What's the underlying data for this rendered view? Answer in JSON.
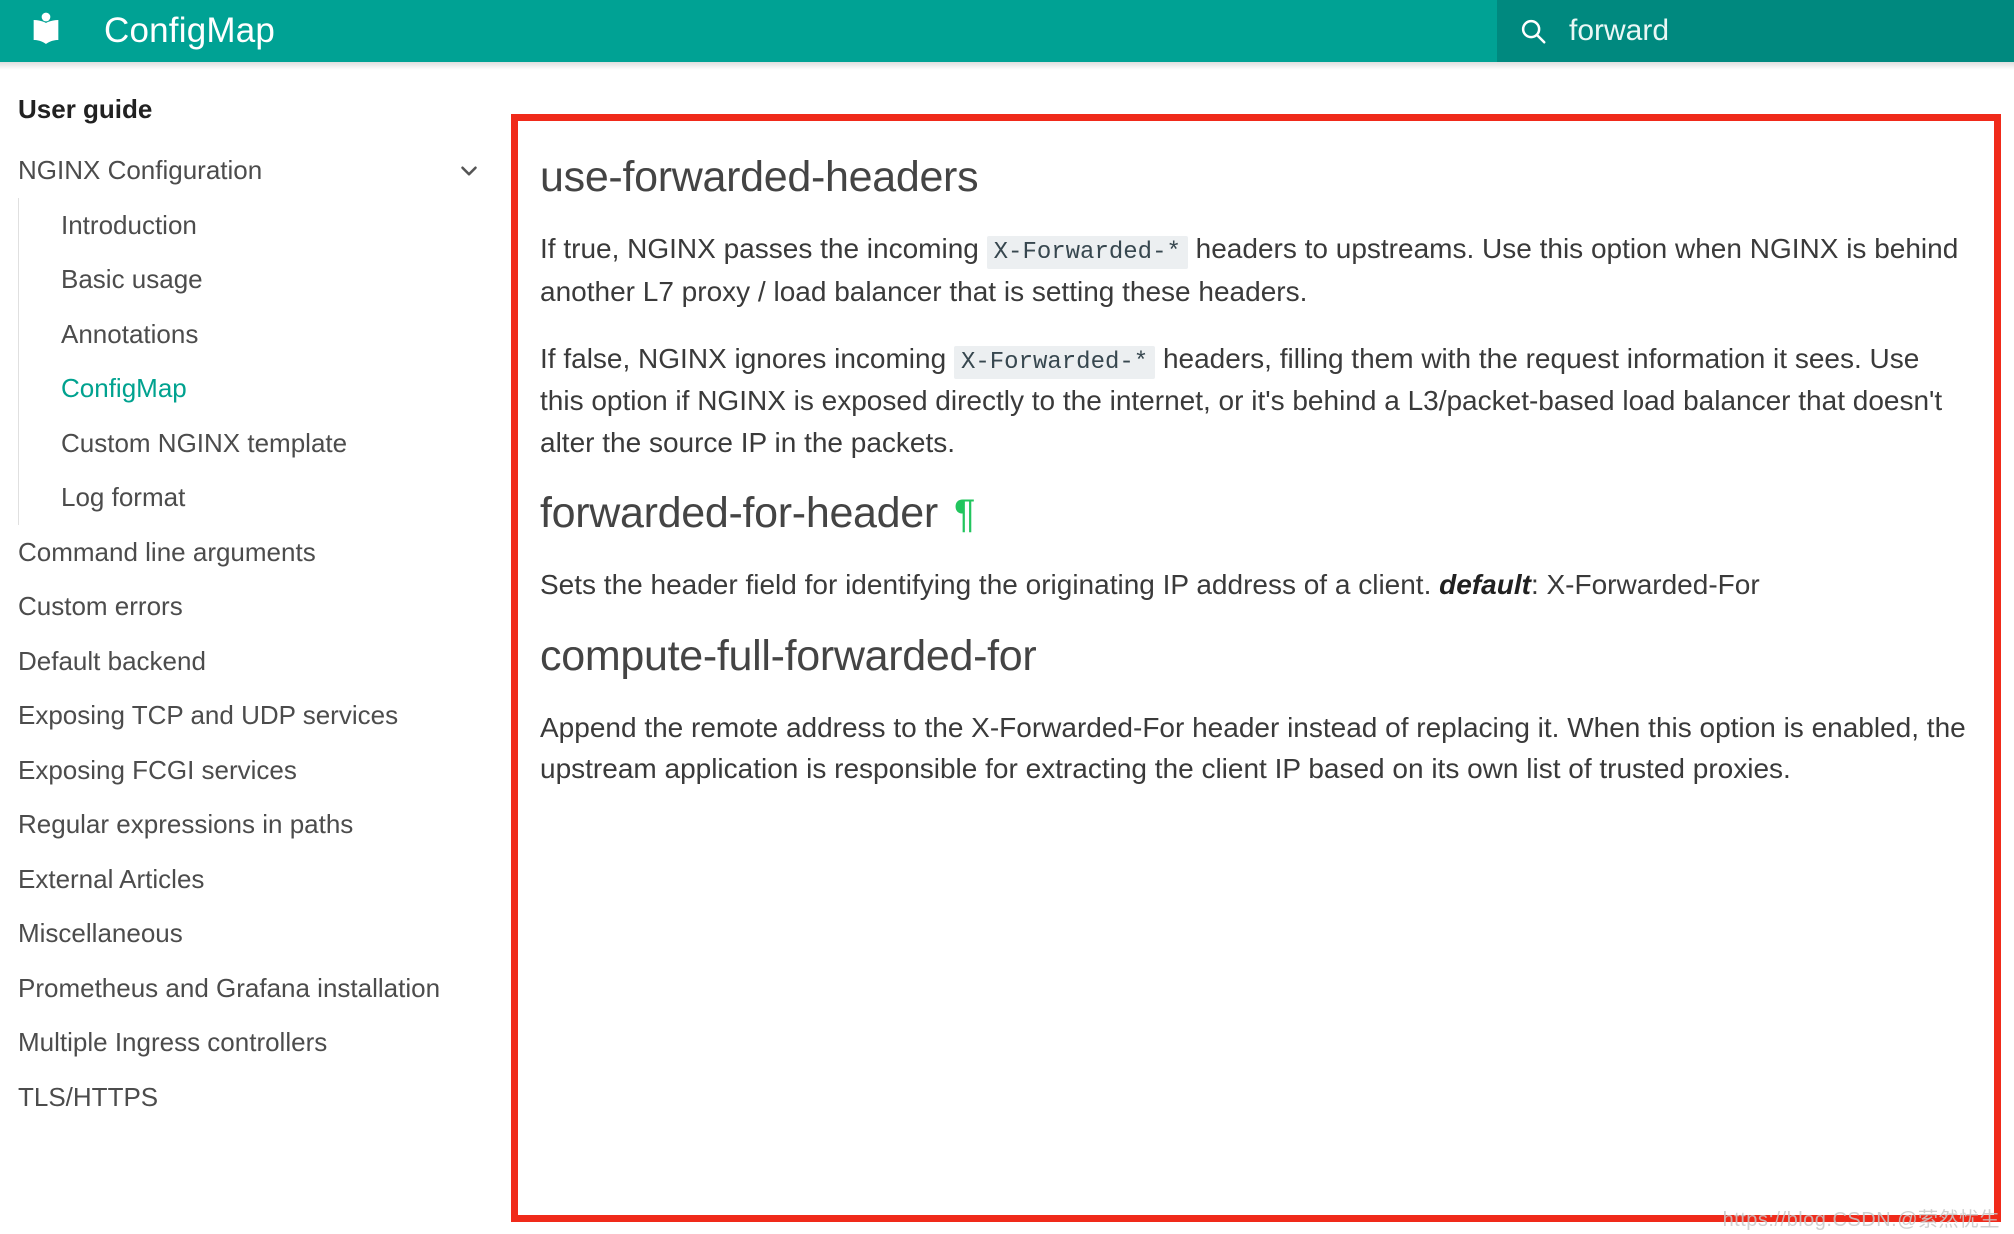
{
  "header": {
    "logo_icon": "book-logo-icon",
    "title": "ConfigMap",
    "brand_color": "#00a294",
    "search": {
      "icon": "search-icon",
      "value": "forward",
      "placeholder": "Search",
      "field_color": "#00897f"
    }
  },
  "sidebar": {
    "title": "User guide",
    "items": [
      {
        "label": "NGINX Configuration",
        "level": 1,
        "active": false,
        "expander": "chevron-down-icon"
      },
      {
        "label": "Introduction",
        "level": 2,
        "active": false
      },
      {
        "label": "Basic usage",
        "level": 2,
        "active": false
      },
      {
        "label": "Annotations",
        "level": 2,
        "active": false
      },
      {
        "label": "ConfigMap",
        "level": 2,
        "active": true
      },
      {
        "label": "Custom NGINX template",
        "level": 2,
        "active": false
      },
      {
        "label": "Log format",
        "level": 2,
        "active": false
      },
      {
        "label": "Command line arguments",
        "level": 1,
        "active": false
      },
      {
        "label": "Custom errors",
        "level": 1,
        "active": false
      },
      {
        "label": "Default backend",
        "level": 1,
        "active": false
      },
      {
        "label": "Exposing TCP and UDP services",
        "level": 1,
        "active": false
      },
      {
        "label": "Exposing FCGI services",
        "level": 1,
        "active": false
      },
      {
        "label": "Regular expressions in paths",
        "level": 1,
        "active": false
      },
      {
        "label": "External Articles",
        "level": 1,
        "active": false
      },
      {
        "label": "Miscellaneous",
        "level": 1,
        "active": false
      },
      {
        "label": "Prometheus and Grafana installation",
        "level": 1,
        "active": false
      },
      {
        "label": "Multiple Ingress controllers",
        "level": 1,
        "active": false
      },
      {
        "label": "TLS/HTTPS",
        "level": 1,
        "active": false
      }
    ],
    "active_color": "#00a28f"
  },
  "annotation": {
    "box_color": "#f02a1a"
  },
  "main": {
    "sections": [
      {
        "heading": "use-forwarded-headers",
        "anchor": "",
        "paragraphs": [
          {
            "parts": [
              {
                "t": "text",
                "v": "If true, NGINX passes the incoming "
              },
              {
                "t": "code",
                "v": "X-Forwarded-*"
              },
              {
                "t": "text",
                "v": " headers to upstreams. Use this option when NGINX is behind another L7 proxy / load balancer that is setting these headers."
              }
            ]
          },
          {
            "parts": [
              {
                "t": "text",
                "v": "If false, NGINX ignores incoming "
              },
              {
                "t": "code",
                "v": "X-Forwarded-*"
              },
              {
                "t": "text",
                "v": " headers, filling them with the request information it sees. Use this option if NGINX is exposed directly to the internet, or it's behind a L3/packet-based load balancer that doesn't alter the source IP in the packets."
              }
            ]
          }
        ]
      },
      {
        "heading": "forwarded-for-header",
        "anchor": "¶",
        "paragraphs": [
          {
            "parts": [
              {
                "t": "text",
                "v": "Sets the header field for identifying the originating IP address of a client. "
              },
              {
                "t": "bolditalic",
                "v": "default"
              },
              {
                "t": "text",
                "v": ": X-Forwarded-For"
              }
            ]
          }
        ]
      },
      {
        "heading": "compute-full-forwarded-for",
        "anchor": "",
        "paragraphs": [
          {
            "parts": [
              {
                "t": "text",
                "v": "Append the remote address to the X-Forwarded-For header instead of replacing it. When this option is enabled, the upstream application is responsible for extracting the client IP based on its own list of trusted proxies."
              }
            ]
          }
        ]
      }
    ]
  },
  "watermark": {
    "text": "https://blog.CSDN.@萦然忧生"
  }
}
